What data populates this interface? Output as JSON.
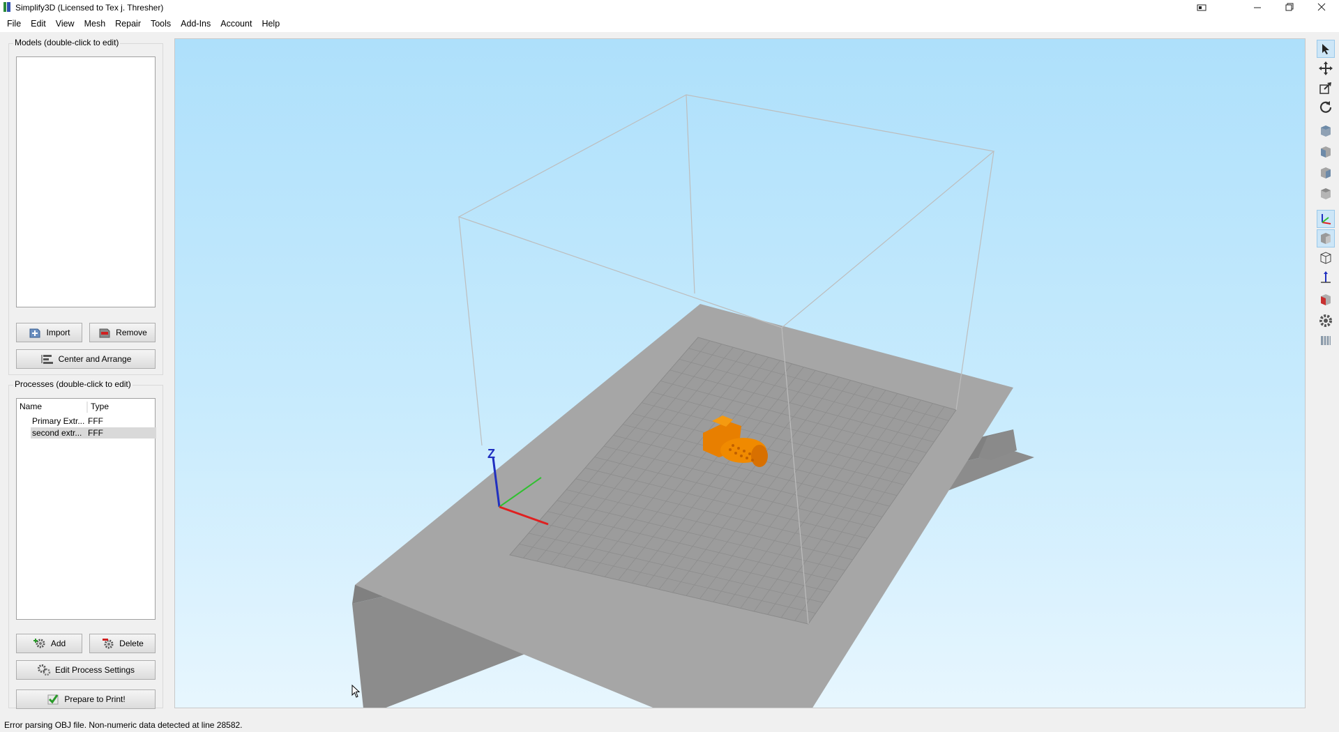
{
  "window": {
    "title": "Simplify3D (Licensed to Tex j. Thresher)",
    "controls": [
      "snap-icon",
      "minimize-icon",
      "restore-icon",
      "close-icon"
    ]
  },
  "menu": [
    "File",
    "Edit",
    "View",
    "Mesh",
    "Repair",
    "Tools",
    "Add-Ins",
    "Account",
    "Help"
  ],
  "models": {
    "label": "Models (double-click to edit)",
    "items": [],
    "import_label": "Import",
    "remove_label": "Remove",
    "center_label": "Center and Arrange"
  },
  "processes": {
    "label": "Processes (double-click to edit)",
    "columns": [
      "Name",
      "Type"
    ],
    "rows": [
      {
        "name": "Primary Extr...",
        "type": "FFF",
        "selected": false
      },
      {
        "name": "second extr...",
        "type": "FFF",
        "selected": true
      }
    ],
    "add_label": "Add",
    "delete_label": "Delete",
    "edit_label": "Edit Process Settings",
    "prepare_label": "Prepare to Print!"
  },
  "viewport": {
    "axis_z_label": "Z",
    "axis_colors": {
      "x": "#e02020",
      "y": "#30c030",
      "z": "#2030c0"
    },
    "model_color": "#f08a00",
    "bed_color": "#a6a6a6"
  },
  "toolbar": {
    "tools": [
      "select-icon",
      "move-icon",
      "scale-icon",
      "rotate-icon",
      "view-default-icon",
      "view-front-icon",
      "view-top-icon",
      "view-side-icon",
      "axes-icon",
      "solid-view-icon",
      "wireframe-icon",
      "normals-icon",
      "cross-section-icon",
      "settings-gear-icon",
      "layers-icon"
    ]
  },
  "status": {
    "message": "Error parsing OBJ file.  Non-numeric data detected at line 28582."
  }
}
